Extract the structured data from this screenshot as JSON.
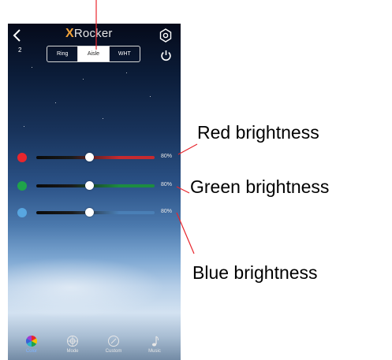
{
  "app": {
    "brand_x": "X",
    "brand_rest": "Rocker",
    "page_number": "2"
  },
  "mode_segments": [
    {
      "label": "Ring",
      "active": false
    },
    {
      "label": "Aisle",
      "active": true
    },
    {
      "label": "WHT",
      "active": false
    }
  ],
  "sliders": [
    {
      "name": "red",
      "value_text": "80%",
      "value": 0.45,
      "color": "#e8262d",
      "track_color": "#c62a2f"
    },
    {
      "name": "green",
      "value_text": "80%",
      "value": 0.45,
      "color": "#1fa34a",
      "track_color": "#1d8c41"
    },
    {
      "name": "blue",
      "value_text": "80%",
      "value": 0.45,
      "color": "#58a6e0",
      "track_color": "#4a7fb6"
    }
  ],
  "bottom_nav": [
    {
      "label": "Color",
      "icon": "color-wheel-icon",
      "active": true
    },
    {
      "label": "Mode",
      "icon": "mode-icon",
      "active": false
    },
    {
      "label": "Custom",
      "icon": "custom-icon",
      "active": false
    },
    {
      "label": "Music",
      "icon": "music-note-icon",
      "active": false
    }
  ],
  "annotations": {
    "red": "Red brightness",
    "green": "Green brightness",
    "blue": "Blue brightness"
  },
  "colors": {
    "brand_accent": "#f0a23a",
    "annotation_line": "#e8262d"
  }
}
